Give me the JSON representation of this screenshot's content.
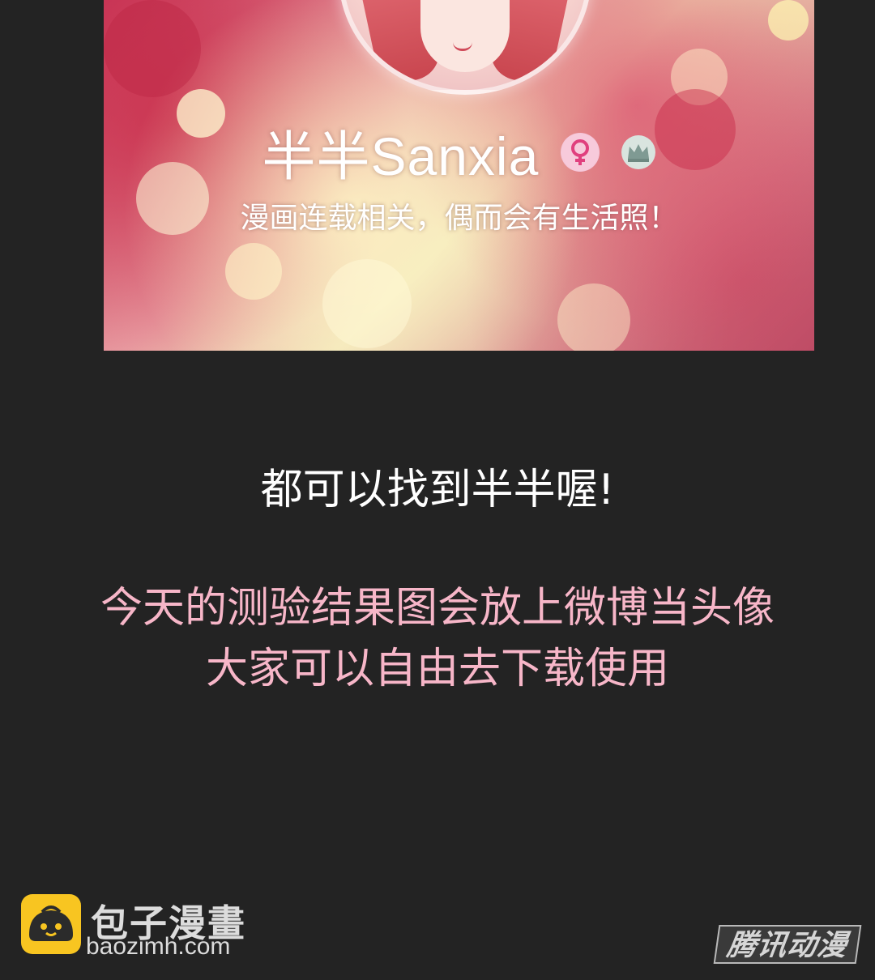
{
  "profile": {
    "name": "半半Sanxia",
    "bio": "漫画连载相关，偶而会有生活照！",
    "gender_icon": "female-icon",
    "member_icon": "crown-icon"
  },
  "body": {
    "line1": "都可以找到半半喔!",
    "line2": "今天的测验结果图会放上微博当头像",
    "line3": "大家可以自由去下载使用",
    "line1_color": "#ffffff",
    "highlight_color": "#f7b6c8"
  },
  "watermark": {
    "site_title": "包子漫畫",
    "site_url": "baozimh.com",
    "publisher_mark": "腾讯动漫",
    "logo_color": "#f8c521"
  }
}
